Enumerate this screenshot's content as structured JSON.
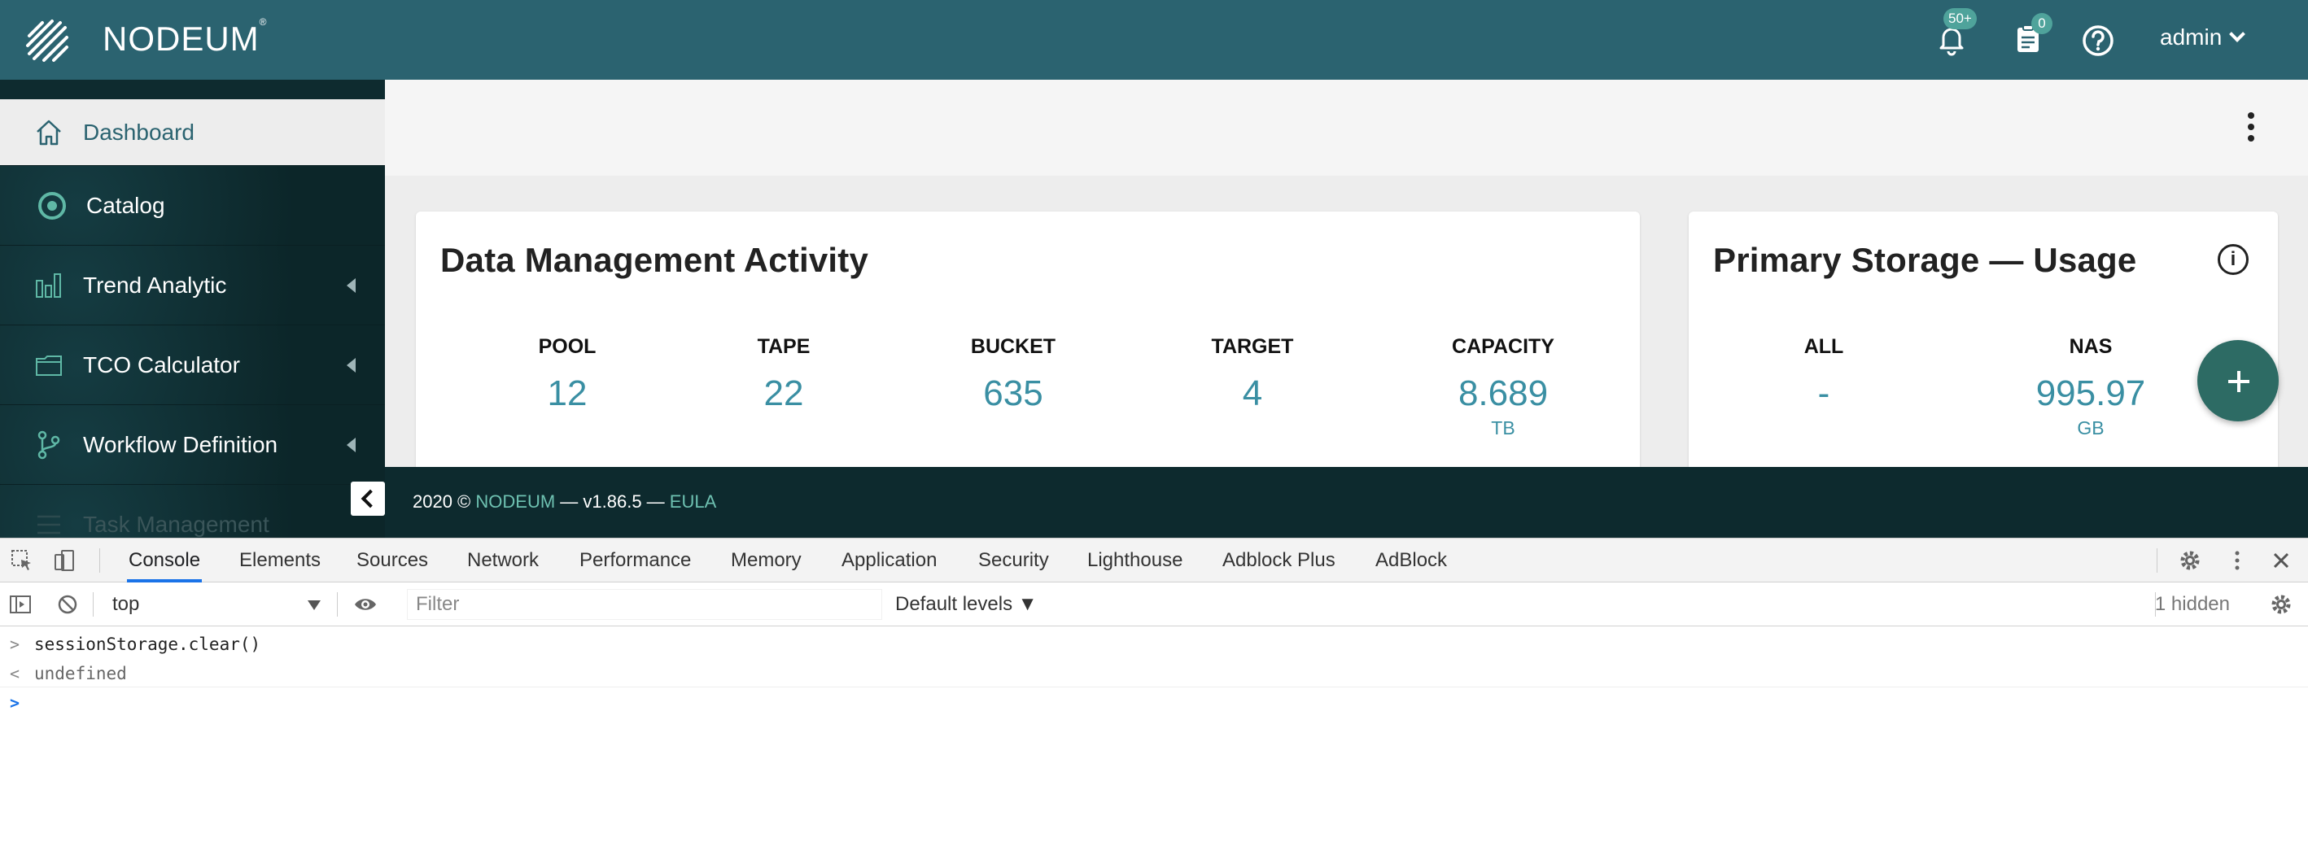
{
  "topbar": {
    "brand": "NODEUM",
    "brand_mark": "®",
    "notifications_badge": "50+",
    "tasks_badge": "0",
    "user_name": "admin"
  },
  "sidebar": {
    "items": [
      {
        "label": "Dashboard",
        "icon": "home-icon"
      },
      {
        "label": "Catalog",
        "icon": "target-icon"
      },
      {
        "label": "Trend Analytic",
        "icon": "bar-chart-icon"
      },
      {
        "label": "TCO Calculator",
        "icon": "folder-icon"
      },
      {
        "label": "Workflow Definition",
        "icon": "branch-icon"
      },
      {
        "label": "Task Management",
        "icon": "list-icon"
      }
    ]
  },
  "data_activity": {
    "title": "Data Management Activity",
    "stats": [
      {
        "key": "POOL",
        "value": "12",
        "unit": ""
      },
      {
        "key": "TAPE",
        "value": "22",
        "unit": ""
      },
      {
        "key": "BUCKET",
        "value": "635",
        "unit": ""
      },
      {
        "key": "TARGET",
        "value": "4",
        "unit": ""
      },
      {
        "key": "CAPACITY",
        "value": "8.689",
        "unit": "TB"
      }
    ]
  },
  "primary_storage": {
    "title": "Primary Storage — Usage",
    "stats": [
      {
        "key": "ALL",
        "value": "-",
        "unit": ""
      },
      {
        "key": "NAS",
        "value": "995.97",
        "unit": "GB"
      }
    ]
  },
  "footer": {
    "copyright": "2020 © ",
    "brand": "NODEUM",
    "version": " — v1.86.5 — ",
    "eula": "EULA"
  },
  "devtools": {
    "tabs": [
      "Console",
      "Elements",
      "Sources",
      "Network",
      "Performance",
      "Memory",
      "Application",
      "Security",
      "Lighthouse",
      "Adblock Plus",
      "AdBlock"
    ],
    "active_tab": "Console",
    "context": "top",
    "filter_placeholder": "Filter",
    "levels": "Default levels ▼",
    "hidden": "1 hidden",
    "lines": [
      {
        "prefix": ">",
        "text": "sessionStorage.clear()"
      },
      {
        "prefix": "<",
        "text": "undefined"
      },
      {
        "prefix": ">",
        "text": ""
      }
    ]
  },
  "colors": {
    "topbar": "#2b6370",
    "sidebar": "#0d2a2e",
    "accent": "#3a8fa3",
    "fab": "#2d6b64"
  }
}
